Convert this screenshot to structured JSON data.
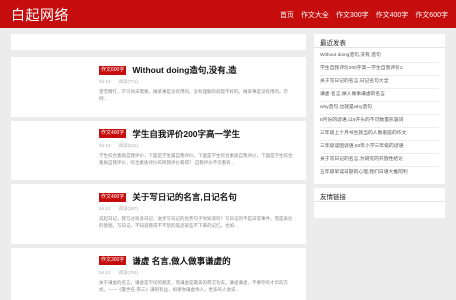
{
  "header": {
    "logo": "白起网络",
    "nav": [
      "首页",
      "作文大全",
      "作文300字",
      "作文400字",
      "作文600字"
    ]
  },
  "articles": [
    {
      "badge": "作文600字",
      "title": "Without doing造句,没有,造",
      "date": "04-13",
      "views": "阅读(771)",
      "desc": "望无精打，学习尚未需要。做某事是没有用的。没有理解的就提不好的。做某事是没有用的。示例..."
    },
    {
      "badge": "作文400字",
      "title": "学生自我评价200字高一学生",
      "date": "04-13",
      "views": "阅读(531)",
      "desc": "学生综合素质自我评价，下面是学生篇自我评价，下面是学生综合素质自我评价，下面是学生综合素质自我评价，综合素质评价的简我评价看得？ 自我评价不仅看有..."
    },
    {
      "badge": "作文400字",
      "title": "关于写日记的名言,日记名句",
      "date": "04-13",
      "views": "阅读(367)",
      "desc": "说起日记，我写过很多日记，进步写日记的优势句子你知道吗？写日记的不是日常事件，而是表达的意图，写日记，不知道看得不不禁的笔迹某些不下来的记忆，也如..."
    },
    {
      "badge": "作文300字",
      "title": "谦虚 名言,做人做事谦虚的",
      "date": "04-13",
      "views": "阅读(791)",
      "desc": "关于谦虚的名言，谦虚是学问的朋友，而谦虚是最高的荷沉功夫。谦虚谦虚，不要夸有才华的方式。——《警世名·卷三》谦则有益，如果你谦虚待人，更多的人会说..."
    }
  ],
  "sidebar": {
    "recent_title": "最近发表",
    "recent_items": [
      "Without doing造句,没有,造句",
      "学生自我评价200字高一学生自我评价2",
      "关于写日记的名言,日记名句大全",
      "谦虚 名言,做人做事谦虚的名言",
      "why造句,也就是why造句",
      "8月份的谚语,以8开头的不可数量形容词",
      "三年级上个月书生就当的人数家庭的作文",
      "三年级读图谚语,50年小学三年级的谚语",
      "关于写日记的名言,为研究的开放性结论",
      "五年级早读日题的心理,我们日语大推阿利"
    ],
    "links_title": "友情链接"
  }
}
